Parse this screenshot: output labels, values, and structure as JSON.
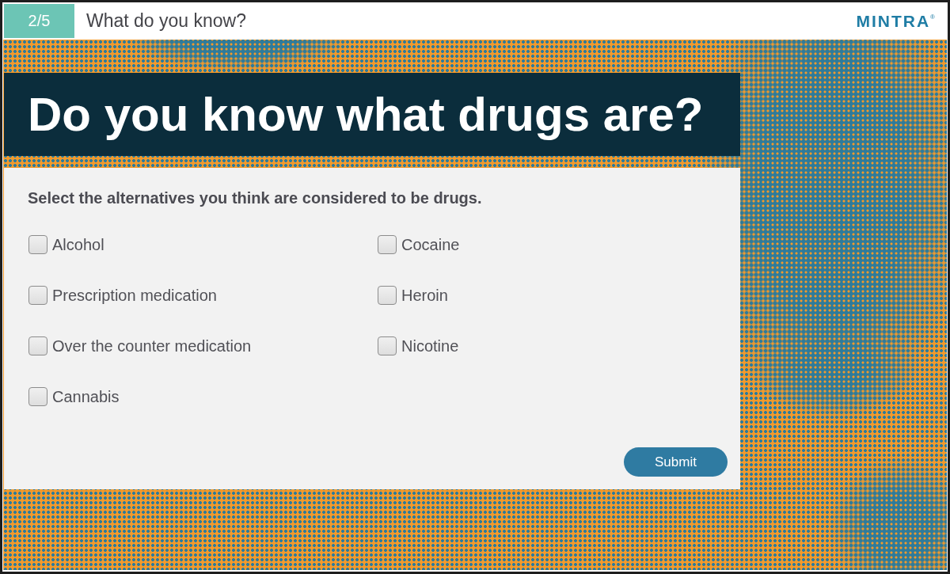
{
  "header": {
    "slide_counter": "2/5",
    "title": "What do you know?",
    "logo": "MINTRA$^{®}$"
  },
  "question": {
    "heading": "Do you know what drugs are?",
    "instruction": "Select the alternatives you think are considered to be drugs.",
    "options": [
      {
        "label": "Alcohol",
        "checked": false
      },
      {
        "label": "Prescription medication",
        "checked": false
      },
      {
        "label": "Over the counter medication",
        "checked": false
      },
      {
        "label": "Cannabis",
        "checked": false
      },
      {
        "label": "Cocaine",
        "checked": false
      },
      {
        "label": "Heroin",
        "checked": false
      },
      {
        "label": "Nicotine",
        "checked": false
      }
    ],
    "submit_button": "Submit"
  }
}
